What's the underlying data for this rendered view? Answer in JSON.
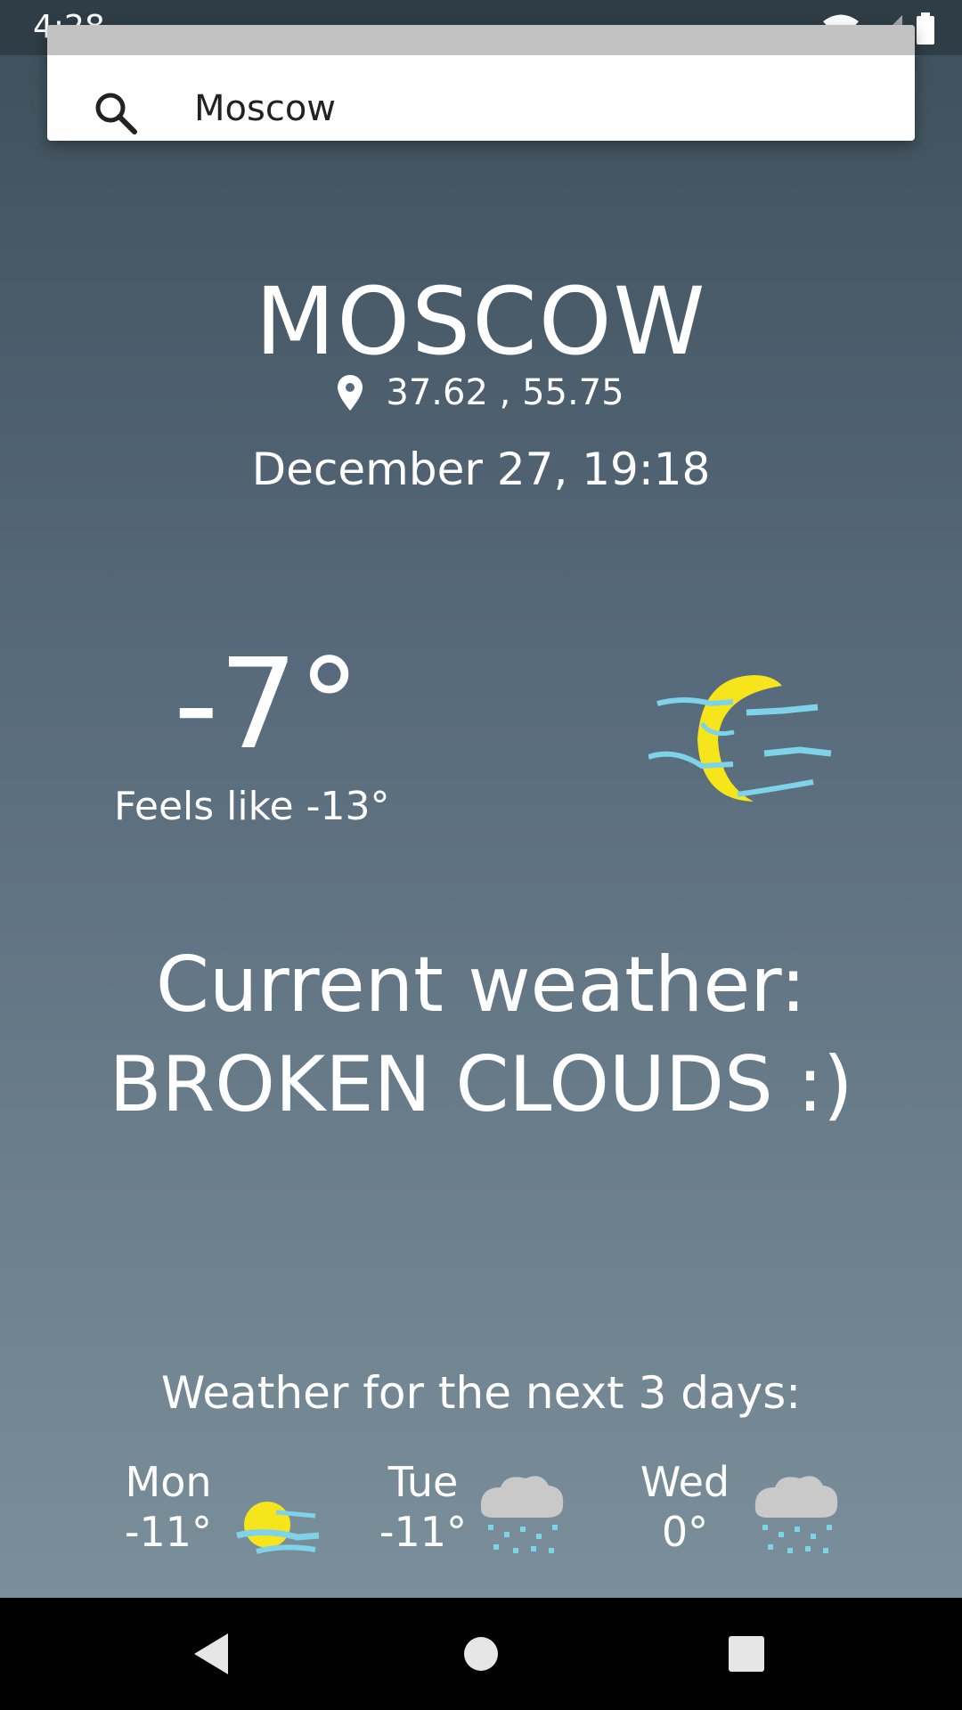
{
  "status_bar": {
    "time": "4:28",
    "wifi_icon": "wifi-icon",
    "signal_icon": "cell-signal-icon",
    "battery_icon": "battery-icon"
  },
  "search": {
    "value": "Moscow",
    "icon": "search-icon"
  },
  "location": {
    "city": "MOSCOW",
    "coordinates": "37.62 , 55.75",
    "pin_icon": "location-pin-icon",
    "datetime": "December 27, 19:18"
  },
  "current": {
    "temperature": "-7°",
    "feels_like": "Feels like -13°",
    "icon": "moon-clouds-icon",
    "description_line1": "Current weather:",
    "description_line2": "BROKEN CLOUDS :)"
  },
  "forecast": {
    "title": "Weather for the next 3 days:",
    "days": [
      {
        "day": "Mon",
        "temp": "-11°",
        "icon": "sun-clouds-icon"
      },
      {
        "day": "Tue",
        "temp": "-11°",
        "icon": "snow-cloud-icon"
      },
      {
        "day": "Wed",
        "temp": "0°",
        "icon": "snow-cloud-icon"
      }
    ]
  },
  "colors": {
    "background_top": "#3e4f5a",
    "background_bottom": "#7a8f9b",
    "sun_yellow": "#f5e51a",
    "cloud_blue": "#7fd3e8"
  },
  "nav": {
    "back_icon": "back-icon",
    "home_icon": "home-icon",
    "recents_icon": "recents-icon"
  }
}
